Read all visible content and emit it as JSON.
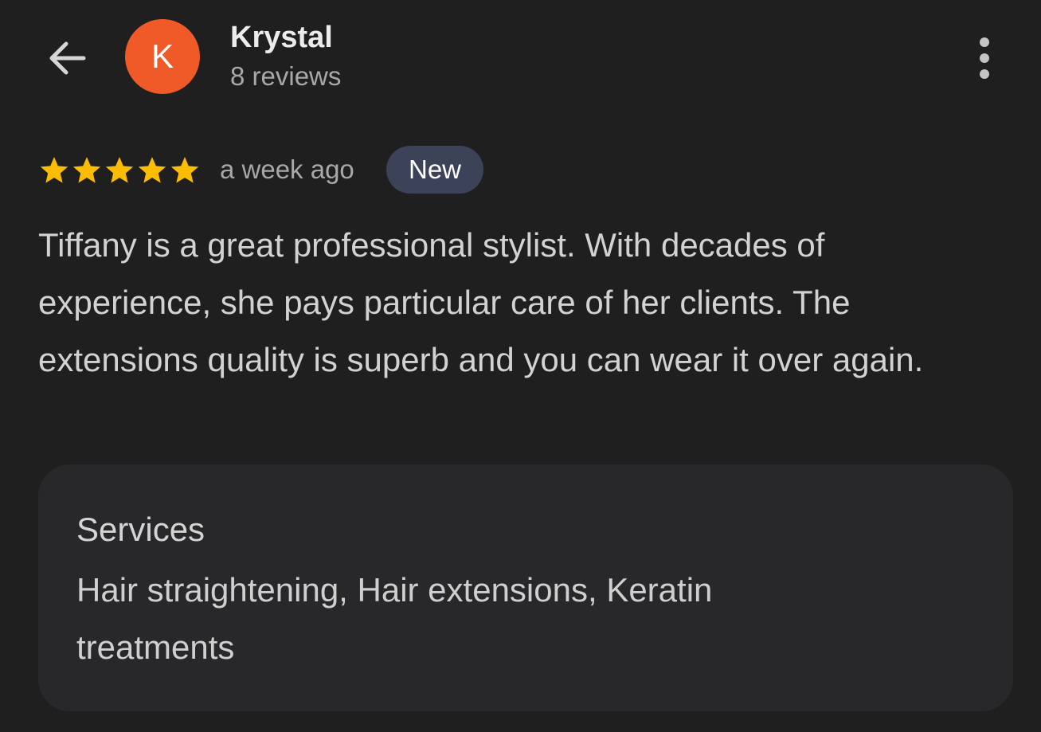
{
  "reviewer": {
    "initial": "K",
    "avatar_color": "#f05a28",
    "name": "Krystal",
    "review_count": "8 reviews"
  },
  "review": {
    "rating": 5,
    "max_rating": 5,
    "star_color": "#fbbc04",
    "time_ago": "a week ago",
    "badge": "New",
    "text": "Tiffany is a great professional stylist. With decades of experience, she pays particular care of her clients. The extensions quality is superb and you can wear it over again."
  },
  "services": {
    "title": "Services",
    "list": "Hair straightening, Hair extensions, Keratin treatments"
  },
  "icons": {
    "back": "arrow-back-icon",
    "more": "more-vert-icon",
    "star": "star-icon"
  }
}
